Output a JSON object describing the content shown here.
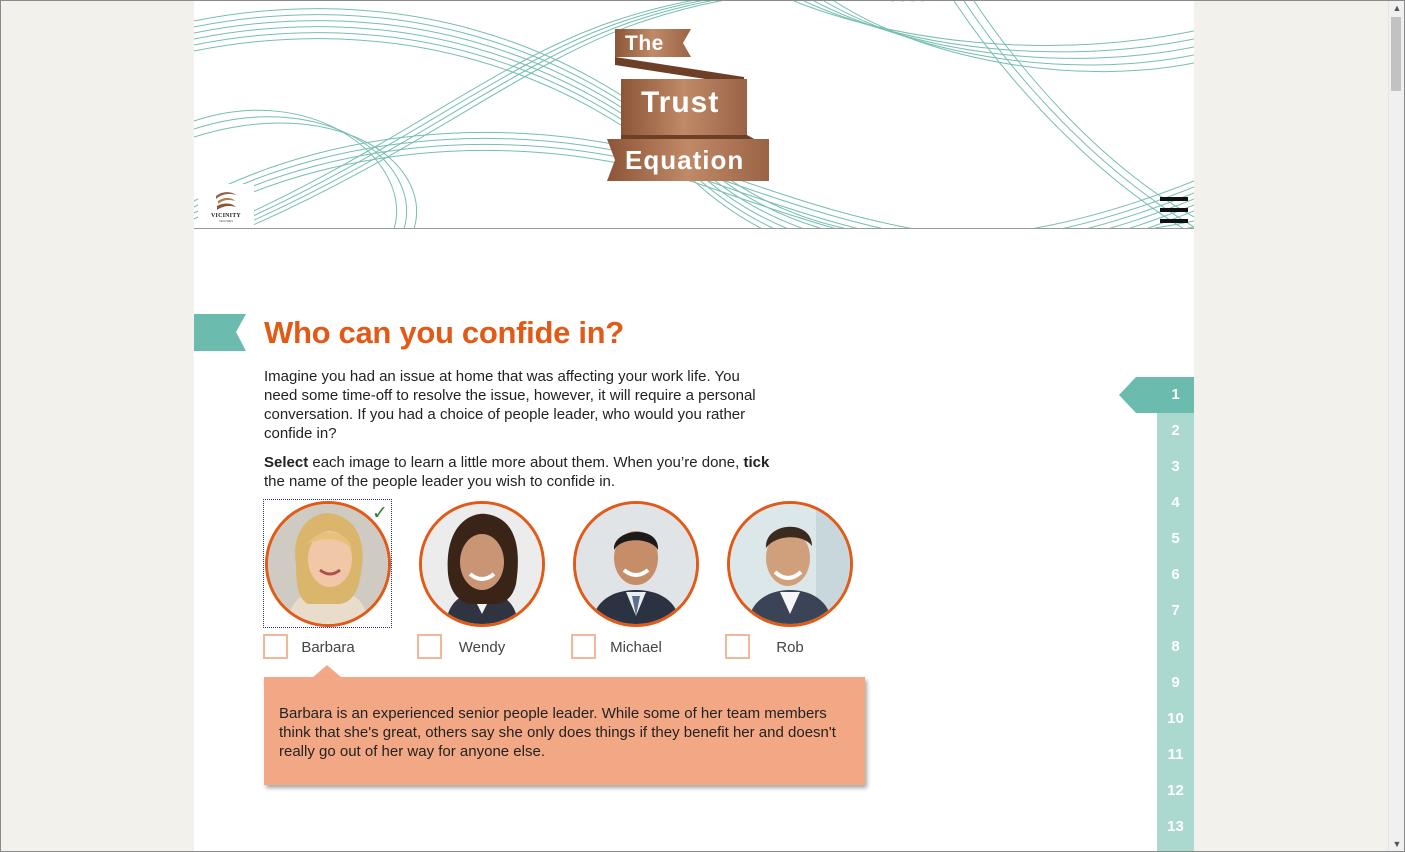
{
  "header": {
    "title_line1": "The",
    "title_line2": "Trust",
    "title_line3": "Equation",
    "logo_text": "VICINITY",
    "logo_subtext": "CENTRES",
    "menu_icon": "hamburger-menu-icon"
  },
  "content": {
    "heading": "Who can you confide in?",
    "intro": "Imagine you had an issue at home that was affecting your work life. You need some time-off to resolve the issue, however, it will require a personal conversation. If you had a choice of people leader, who would you rather confide in?",
    "instruct_bold1": "Select",
    "instruct_part1": " each image to learn a little more about them. When you’re done, ",
    "instruct_bold2": "tick",
    "instruct_part2": " the name of the people leader you wish to confide in.",
    "people": [
      {
        "name": "Barbara",
        "viewed": true,
        "checked": false
      },
      {
        "name": "Wendy",
        "viewed": false,
        "checked": false
      },
      {
        "name": "Michael",
        "viewed": false,
        "checked": false
      },
      {
        "name": "Rob",
        "viewed": false,
        "checked": false
      }
    ],
    "popup_text": "Barbara is an experienced senior people leader. While some of her team members think that she's great, others say she only does things if they benefit her and doesn't really go out of her way for anyone else."
  },
  "page_nav": {
    "active": "1",
    "items": [
      "1",
      "2",
      "3",
      "4",
      "5",
      "6",
      "7",
      "8",
      "9",
      "10",
      "11",
      "12",
      "13"
    ]
  },
  "colors": {
    "accent_orange": "#e35a16",
    "teal": "#6bbcae",
    "nav_teal": "#acd9cf",
    "popup_bg": "#f3a885",
    "ribbon_copper": "#a46a48"
  }
}
